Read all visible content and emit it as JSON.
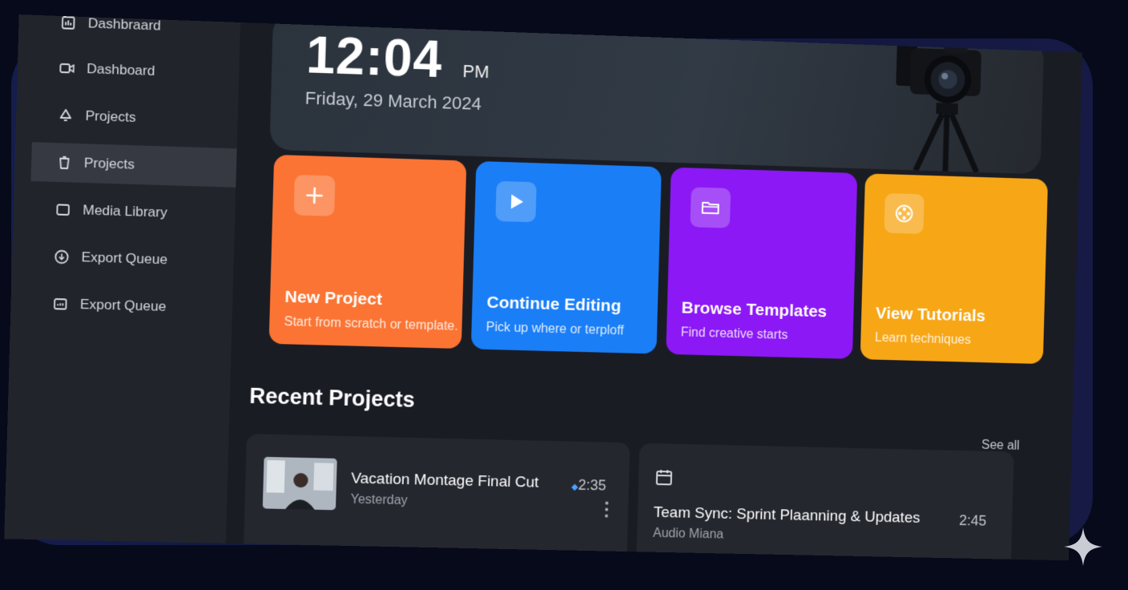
{
  "clock": {
    "time": "12:04",
    "ampm": "PM",
    "date": "Friday, 29 March 2024"
  },
  "sidebar": {
    "items": [
      {
        "label": "Dashbraard",
        "icon": "chart-icon"
      },
      {
        "label": "Dashboard",
        "icon": "video-icon"
      },
      {
        "label": "Projects",
        "icon": "bell-icon"
      },
      {
        "label": "Projects",
        "icon": "trash-icon",
        "active": true
      },
      {
        "label": "Media Library",
        "icon": "square-icon"
      },
      {
        "label": "Export Queue",
        "icon": "download-circle-icon"
      },
      {
        "label": "Export Queue",
        "icon": "export-box-icon"
      }
    ]
  },
  "actions": [
    {
      "title": "New Project",
      "subtitle": "Start from scratch or template.",
      "icon": "plus-icon",
      "color": "#fb7433"
    },
    {
      "title": "Continue Editing",
      "subtitle": "Pick up where or terploff",
      "icon": "play-icon",
      "color": "#1a7ef7"
    },
    {
      "title": "Browse Templates",
      "subtitle": "Find creative starts",
      "icon": "folder-icon",
      "color": "#8b18f5"
    },
    {
      "title": "View Tutorials",
      "subtitle": "Learn techniques",
      "icon": "film-reel-icon",
      "color": "#f7a616"
    }
  ],
  "recent": {
    "title": "Recent Projects",
    "see_all": "See all",
    "items": [
      {
        "title": "Vacation Montage Final Cut",
        "subtitle": "Yesterday",
        "duration": "2:35"
      },
      {
        "title": "Team Sync: Sprint Plaanning & Updates",
        "subtitle": "Audio Miana",
        "duration": "2:45",
        "icon": "calendar-icon"
      }
    ]
  }
}
